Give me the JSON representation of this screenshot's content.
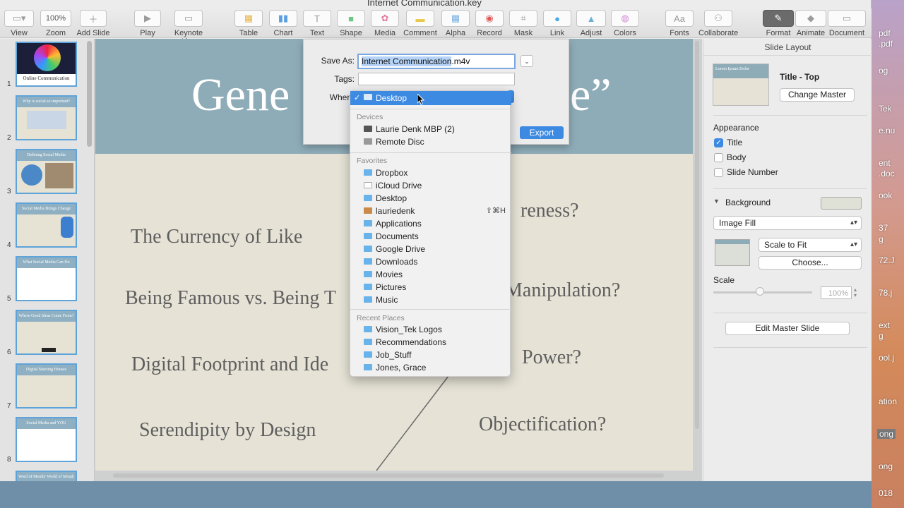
{
  "window": {
    "title": "Internet Communication.key"
  },
  "toolbar": {
    "view": "View",
    "zoom": "Zoom",
    "zoom_value": "100%",
    "add_slide": "Add Slide",
    "play": "Play",
    "keynote_live": "Keynote Live",
    "table": "Table",
    "chart": "Chart",
    "text": "Text",
    "shape": "Shape",
    "media": "Media",
    "comment": "Comment",
    "alpha": "Alpha",
    "record": "Record",
    "mask": "Mask",
    "link": "Link",
    "adjust": "Adjust",
    "colors": "Colors",
    "fonts": "Fonts",
    "fonts_glyph": "Aa",
    "collaborate": "Collaborate",
    "format": "Format",
    "animate": "Animate",
    "document": "Document"
  },
  "navigator": {
    "slides": [
      {
        "num": "1",
        "title": "Online Communication"
      },
      {
        "num": "2",
        "title": "Why is social so important?"
      },
      {
        "num": "3",
        "title": "Defining Social Media"
      },
      {
        "num": "4",
        "title": "Social Media Brings Change"
      },
      {
        "num": "5",
        "title": "What Social Media Can Do"
      },
      {
        "num": "6",
        "title": "Where Good Ideas Come From?"
      },
      {
        "num": "7",
        "title": "Digital Meeting Houses"
      },
      {
        "num": "8",
        "title": "Social Media  and YOU"
      },
      {
        "num": "9",
        "title": "Word of Mouth/ World of Mouth"
      }
    ]
  },
  "slide": {
    "title_left": "Gene",
    "title_right": "e”",
    "items": [
      "The Currency of Like",
      "Being Famous vs. Being T",
      "Digital Footprint and Ide",
      "Serendipity by Design",
      "reness?",
      "Manipulation?",
      "Power?",
      "Objectification?"
    ]
  },
  "save_sheet": {
    "save_as_label": "Save As:",
    "filename": "Internet Communication.m4v",
    "filename_selected": "Internet Communication",
    "filename_ext": ".m4v",
    "tags_label": "Tags:",
    "where_label": "Where",
    "export": "Export"
  },
  "where_menu": {
    "selected": "Desktop",
    "devices_header": "Devices",
    "devices": [
      "Laurie Denk MBP (2)",
      "Remote Disc"
    ],
    "favorites_header": "Favorites",
    "favorites": [
      "Dropbox",
      "iCloud Drive",
      "Desktop",
      "lauriedenk",
      "Applications",
      "Documents",
      "Google Drive",
      "Downloads",
      "Movies",
      "Pictures",
      "Music"
    ],
    "home_shortcut": "⇧⌘H",
    "recent_header": "Recent Places",
    "recent": [
      "Vision_Tek Logos",
      "Recommendations",
      "Job_Stuff",
      "Jones, Grace"
    ]
  },
  "inspector": {
    "header": "Slide Layout",
    "master_thumb_text": "Lorem Ipsum Dolor",
    "master_name": "Title - Top",
    "change_master": "Change Master",
    "appearance": "Appearance",
    "title_opt": "Title",
    "body_opt": "Body",
    "slide_number_opt": "Slide Number",
    "title_checked": true,
    "body_checked": false,
    "slide_number_checked": false,
    "background": "Background",
    "fill_type": "Image Fill",
    "scale_mode": "Scale to Fit",
    "choose": "Choose...",
    "scale_label": "Scale",
    "scale_value": "100%",
    "edit_master": "Edit Master Slide"
  },
  "desktop_files": [
    "pdf",
    ".pdf",
    "og",
    "Tek",
    "e.nu",
    "ent",
    ".doc",
    "ook",
    "37",
    "g",
    "72.J",
    "78.j",
    "ext",
    "g",
    "ool.j",
    "ation",
    "ong",
    "ong",
    "018"
  ],
  "colors": {
    "accent": "#3d8ae3",
    "slide_band": "#8eacb8",
    "slide_bg": "#e6e3d6"
  }
}
